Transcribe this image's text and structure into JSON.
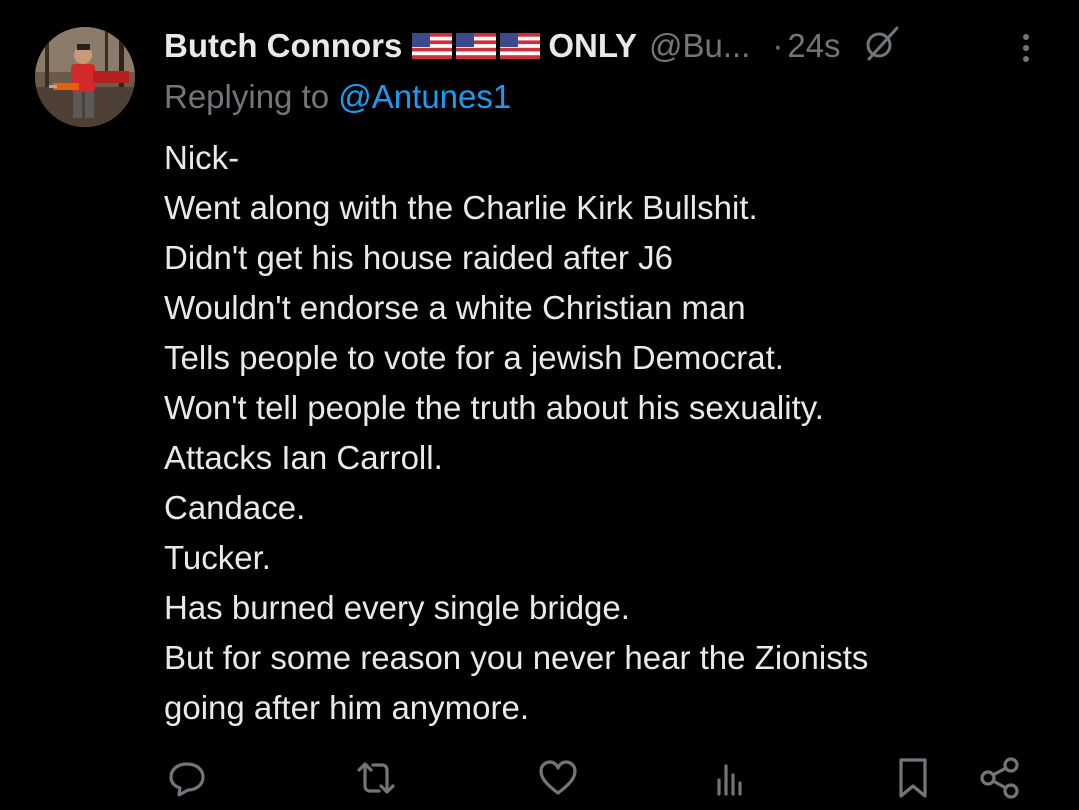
{
  "author": {
    "display_name": "Butch Connors",
    "flags": [
      "us-flag",
      "us-flag",
      "us-flag"
    ],
    "name_suffix": "ONLY",
    "handle": "@Bu...",
    "separator": "·",
    "timestamp": "24s"
  },
  "reply": {
    "prefix": "Replying to",
    "mention": "@Antunes1"
  },
  "body_lines": [
    "Nick-",
    "Went along with the Charlie Kirk Bullshit.",
    "Didn't get his house raided after J6",
    "Wouldn't endorse a white Christian man",
    "Tells people to vote for a jewish Democrat.",
    "Won't tell people the truth about his sexuality.",
    "Attacks Ian Carroll.",
    "Candace.",
    "Tucker.",
    "Has burned every single bridge.",
    "But for some reason you never hear the Zionists",
    "going after him anymore."
  ],
  "actions": [
    "reply-icon",
    "retweet-icon",
    "like-icon",
    "views-icon",
    "bookmark-icon",
    "share-icon"
  ],
  "icons": {
    "grok": "grok-icon",
    "more": "more-icon"
  },
  "colors": {
    "background": "#000000",
    "text": "#e7e9ea",
    "secondary": "#71767b",
    "accent": "#1d9bf0"
  }
}
